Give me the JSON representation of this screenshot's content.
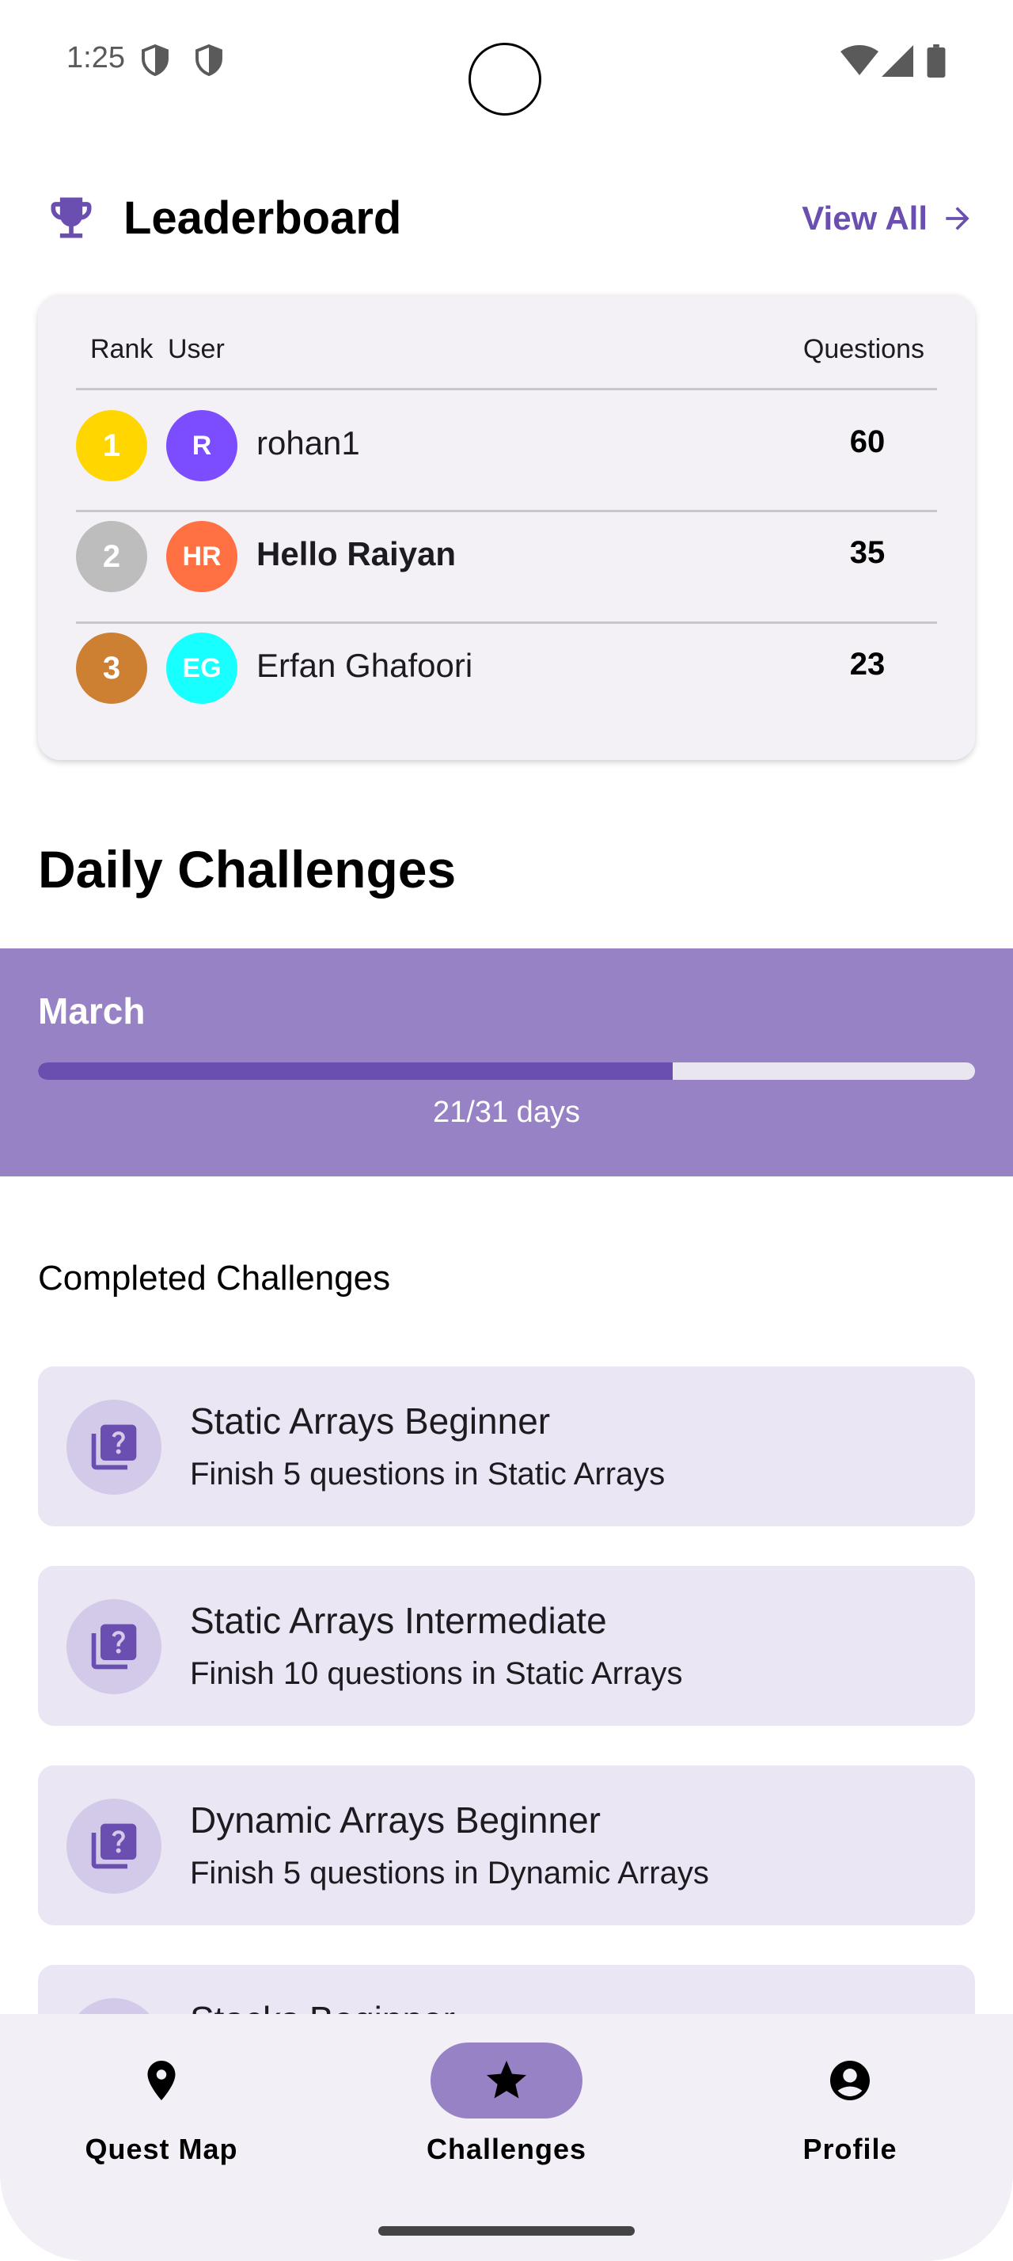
{
  "status_bar": {
    "time": "1:25",
    "icons": [
      "shield-icon",
      "shield-icon",
      "wifi-icon",
      "signal-icon",
      "battery-icon"
    ]
  },
  "leaderboard": {
    "title": "Leaderboard",
    "view_all_label": "View All",
    "columns": {
      "rank": "Rank",
      "user": "User",
      "questions": "Questions"
    },
    "rows": [
      {
        "rank": "1",
        "initials": "R",
        "name": "rohan1",
        "questions": "60",
        "rank_color": "#FFD600",
        "avatar_color": "#7C4DFF",
        "highlight": false
      },
      {
        "rank": "2",
        "initials": "HR",
        "name": "Hello Raiyan",
        "questions": "35",
        "rank_color": "#BDBDBD",
        "avatar_color": "#FF7043",
        "highlight": true
      },
      {
        "rank": "3",
        "initials": "EG",
        "name": "Erfan Ghafoori",
        "questions": "23",
        "rank_color": "#CD7F32",
        "avatar_color": "#18FFFF",
        "highlight": false
      }
    ]
  },
  "daily_challenges": {
    "title": "Daily Challenges",
    "month": "March",
    "progress_text": "21/31 days",
    "progress_fraction": 0.6774
  },
  "completed": {
    "label": "Completed Challenges",
    "items": [
      {
        "title": "Static Arrays Beginner",
        "description": "Finish 5 questions in Static Arrays"
      },
      {
        "title": "Static Arrays Intermediate",
        "description": "Finish 10 questions in Static Arrays"
      },
      {
        "title": "Dynamic Arrays Beginner",
        "description": "Finish 5 questions in Dynamic Arrays"
      },
      {
        "title": "Stacks Beginner",
        "description": ""
      }
    ]
  },
  "bottom_nav": {
    "items": [
      {
        "label": "Quest Map",
        "icon": "location-pin-icon",
        "active": false
      },
      {
        "label": "Challenges",
        "icon": "star-icon",
        "active": true
      },
      {
        "label": "Profile",
        "icon": "account-circle-icon",
        "active": false
      }
    ]
  },
  "colors": {
    "accent": "#6A4FB0",
    "banner": "#9882C6",
    "card_bg": "#EAE6F3"
  }
}
